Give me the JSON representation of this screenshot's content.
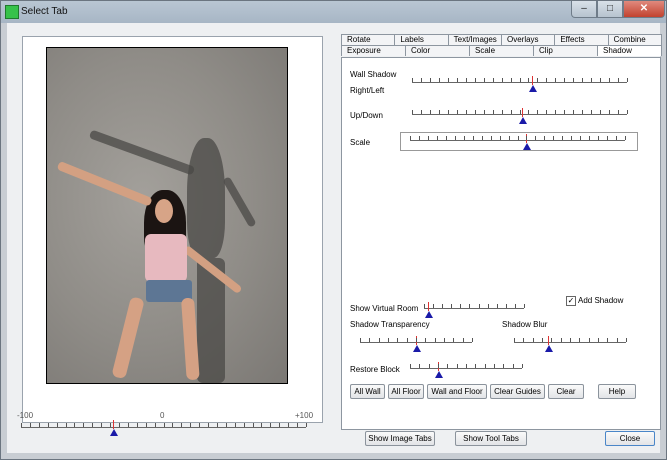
{
  "window": {
    "title": "Select Tab",
    "minimize": "–",
    "maximize": "□",
    "close": "✕"
  },
  "tabs": {
    "row1": [
      "Rotate",
      "Labels",
      "Text/Images",
      "Overlays",
      "Effects",
      "Combine"
    ],
    "row2": [
      "Exposure",
      "Color",
      "Scale",
      "Clip",
      "Shadow"
    ],
    "active": "Shadow"
  },
  "shadow": {
    "wall_shadow": "Wall Shadow",
    "right_left": "Right/Left",
    "up_down": "Up/Down",
    "scale": "Scale",
    "add_shadow": "Add Shadow",
    "add_shadow_checked": true,
    "check_mark": "✓",
    "show_virtual_room": "Show Virtual Room",
    "shadow_transparency": "Shadow Transparency",
    "shadow_blur": "Shadow Blur",
    "restore_block": "Restore Block"
  },
  "buttons": {
    "all_wall": "All Wall",
    "all_floor": "All Floor",
    "wall_and_floor": "Wall and Floor",
    "clear_guides": "Clear Guides",
    "clear": "Clear",
    "help": "Help",
    "show_image_tabs": "Show Image Tabs",
    "show_tool_tabs": "Show Tool Tabs",
    "close": "Close"
  },
  "bottom_slider": {
    "min_label": "-100",
    "mid_label": "0",
    "max_label": "+100"
  },
  "colors": {
    "thumb": "#1a1aa8",
    "marker": "#dd3333",
    "title_icon": "#36c24a"
  }
}
